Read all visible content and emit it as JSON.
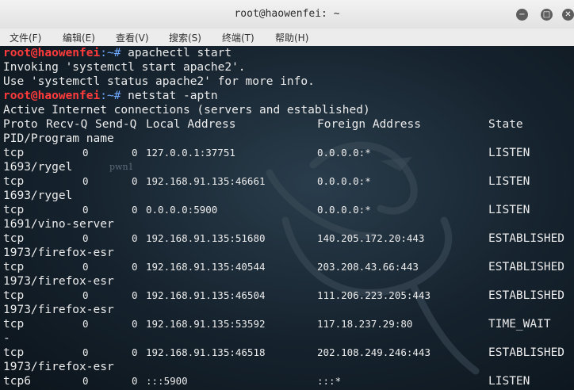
{
  "window": {
    "title": "root@haowenfei: ~",
    "minimize_glyph": "−",
    "maximize_glyph": "□",
    "close_glyph": "✕"
  },
  "menu": {
    "items": [
      "文件(F)",
      "编辑(E)",
      "查看(V)",
      "搜索(S)",
      "终端(T)",
      "帮助(H)"
    ]
  },
  "terminal": {
    "prompt_user": "root@haowenfei",
    "prompt_path": ":~#",
    "cmd1": " apachectl start",
    "out1": "Invoking 'systemctl start apache2'.",
    "out2": "Use 'systemctl status apache2' for more info.",
    "cmd2": " netstat -aptn",
    "header_line": "Active Internet connections (servers and established)",
    "headers": {
      "proto": "Proto",
      "recvq": "Recv-Q",
      "sendq": "Send-Q",
      "local": "Local Address",
      "foreign": "Foreign Address",
      "state": "State",
      "pid": "PID/Program name"
    },
    "watermark": "pwn1",
    "rows": [
      {
        "proto": "tcp",
        "recvq": "0",
        "sendq": "0",
        "local": "127.0.0.1:37751",
        "foreign": "0.0.0.0:*",
        "state": "LISTEN",
        "pid": "1693/rygel"
      },
      {
        "proto": "tcp",
        "recvq": "0",
        "sendq": "0",
        "local": "192.168.91.135:46661",
        "foreign": "0.0.0.0:*",
        "state": "LISTEN",
        "pid": "1693/rygel"
      },
      {
        "proto": "tcp",
        "recvq": "0",
        "sendq": "0",
        "local": "0.0.0.0:5900",
        "foreign": "0.0.0.0:*",
        "state": "LISTEN",
        "pid": "1691/vino-server"
      },
      {
        "proto": "tcp",
        "recvq": "0",
        "sendq": "0",
        "local": "192.168.91.135:51680",
        "foreign": "140.205.172.20:443",
        "state": "ESTABLISHED",
        "pid": "1973/firefox-esr"
      },
      {
        "proto": "tcp",
        "recvq": "0",
        "sendq": "0",
        "local": "192.168.91.135:40544",
        "foreign": "203.208.43.66:443",
        "state": "ESTABLISHED",
        "pid": "1973/firefox-esr"
      },
      {
        "proto": "tcp",
        "recvq": "0",
        "sendq": "0",
        "local": "192.168.91.135:46504",
        "foreign": "111.206.223.205:443",
        "state": "ESTABLISHED",
        "pid": "1973/firefox-esr"
      },
      {
        "proto": "tcp",
        "recvq": "0",
        "sendq": "0",
        "local": "192.168.91.135:53592",
        "foreign": "117.18.237.29:80",
        "state": "TIME_WAIT",
        "pid": "-"
      },
      {
        "proto": "tcp",
        "recvq": "0",
        "sendq": "0",
        "local": "192.168.91.135:46518",
        "foreign": "202.108.249.246:443",
        "state": "ESTABLISHED",
        "pid": "1973/firefox-esr"
      },
      {
        "proto": "tcp6",
        "recvq": "0",
        "sendq": "0",
        "local": ":::5900",
        "foreign": ":::*",
        "state": "LISTEN",
        "pid": ""
      }
    ]
  }
}
